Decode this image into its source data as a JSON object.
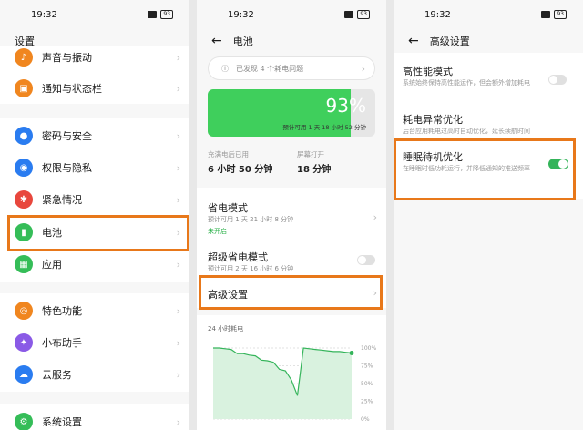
{
  "status": {
    "time": "19:32",
    "battery": "93"
  },
  "settings": {
    "title": "设置",
    "items": [
      {
        "label": "声音与振动",
        "icon": "sound-icon",
        "color": "#f0861f"
      },
      {
        "label": "通知与状态栏",
        "icon": "notification-icon",
        "color": "#f0861f"
      },
      {
        "label": "密码与安全",
        "icon": "lock-icon",
        "color": "#2a7cf0"
      },
      {
        "label": "权限与隐私",
        "icon": "eye-icon",
        "color": "#2a7cf0"
      },
      {
        "label": "紧急情况",
        "icon": "asterisk-icon",
        "color": "#e8473d"
      },
      {
        "label": "电池",
        "icon": "battery-icon",
        "color": "#35bd58"
      },
      {
        "label": "应用",
        "icon": "apps-icon",
        "color": "#35bd58"
      },
      {
        "label": "特色功能",
        "icon": "star-icon",
        "color": "#f0861f"
      },
      {
        "label": "小布助手",
        "icon": "assistant-icon",
        "color": "#8a5ae6"
      },
      {
        "label": "云服务",
        "icon": "cloud-icon",
        "color": "#2a7cf0"
      },
      {
        "label": "系统设置",
        "icon": "system-icon",
        "color": "#35bd58"
      }
    ]
  },
  "battery_page": {
    "title": "电池",
    "notice": "已发现 4 个耗电问题",
    "level_pct": 93,
    "level_text": "93%",
    "estimate": "预计可用 1 天 18 小时 52 分钟",
    "since_charge_label": "充满电后已用",
    "since_charge_value": "6 小时 50 分钟",
    "screen_on_label": "屏幕打开",
    "screen_on_value": "18 分钟",
    "power_save_title": "省电模式",
    "power_save_sub": "预计可用 1 天 21 小时 8 分钟",
    "power_save_status": "未开启",
    "super_save_title": "超级省电模式",
    "super_save_sub": "预计可用 2 天 16 小时 6 分钟",
    "advanced_title": "高级设置",
    "chart_title": "24 小时耗电",
    "chart_ticks": [
      "100%",
      "75%",
      "50%",
      "25%",
      "0%"
    ]
  },
  "chart_data": {
    "type": "line",
    "title": "24 小时耗电",
    "y_ticks": [
      "100%",
      "75%",
      "50%",
      "25%",
      "0%"
    ],
    "ylim": [
      0,
      100
    ],
    "values": [
      100,
      100,
      99,
      98,
      92,
      92,
      90,
      89,
      83,
      82,
      80,
      70,
      68,
      55,
      33,
      100,
      99,
      98,
      97,
      96,
      95,
      95,
      94,
      93
    ]
  },
  "advanced_page": {
    "title": "高级设置",
    "items": [
      {
        "title": "高性能模式",
        "sub": "系统始终保持高性能运作，但会额外增加耗电",
        "toggle": false
      },
      {
        "title": "耗电异常优化",
        "sub": "后台应用耗电过高时自动优化，延长续航时间",
        "toggle": null
      },
      {
        "title": "睡眠待机优化",
        "sub": "在睡眠时低功耗运行，并降低通知的推送频率",
        "toggle": true
      }
    ]
  },
  "colors": {
    "highlight": "#e8781a",
    "battery_green": "#3fcf5c",
    "toggle_on": "#34b45a"
  }
}
